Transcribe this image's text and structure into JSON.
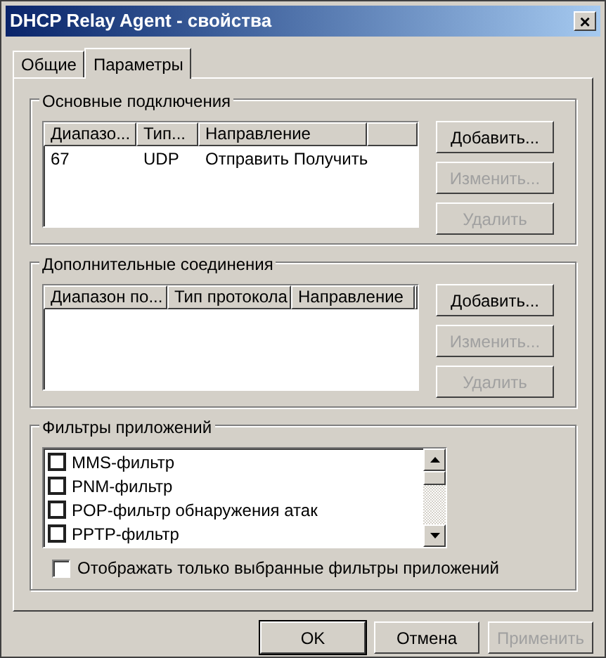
{
  "window": {
    "title": "DHCP Relay Agent - свойства",
    "close": "×"
  },
  "tabs": [
    {
      "label": "Общие",
      "selected": false
    },
    {
      "label": "Параметры",
      "selected": true
    }
  ],
  "groups": [
    {
      "title": "Основные подключения",
      "columns": [
        "Диапазо...",
        "Тип...",
        "Направление"
      ],
      "rows": [
        [
          "67",
          "UDP",
          "Отправить Получить"
        ]
      ],
      "buttons": [
        {
          "label": "Добавить...",
          "disabled": false
        },
        {
          "label": "Изменить...",
          "disabled": true
        },
        {
          "label": "Удалить",
          "disabled": true
        }
      ]
    },
    {
      "title": "Дополнительные соединения",
      "columns": [
        "Диапазон по...",
        "Тип протокола",
        "Направление"
      ],
      "buttons": [
        {
          "label": "Добавить...",
          "disabled": false
        },
        {
          "label": "Изменить...",
          "disabled": true
        },
        {
          "label": "Удалить",
          "disabled": true
        }
      ]
    }
  ],
  "filters": {
    "title": "Фильтры приложений",
    "items": [
      {
        "label": "MMS-фильтр",
        "checked": false
      },
      {
        "label": "PNM-фильтр",
        "checked": false
      },
      {
        "label": "POP-фильтр обнаружения атак",
        "checked": false
      },
      {
        "label": "PPTP-фильтр",
        "checked": false
      }
    ],
    "show_selected": {
      "label": "Отображать только выбранные фильтры приложений",
      "checked": false
    }
  },
  "buttons": [
    {
      "label": "OK",
      "disabled": false,
      "default": true
    },
    {
      "label": "Отмена",
      "disabled": false,
      "default": false
    },
    {
      "label": "Применить",
      "disabled": true,
      "default": false
    }
  ]
}
